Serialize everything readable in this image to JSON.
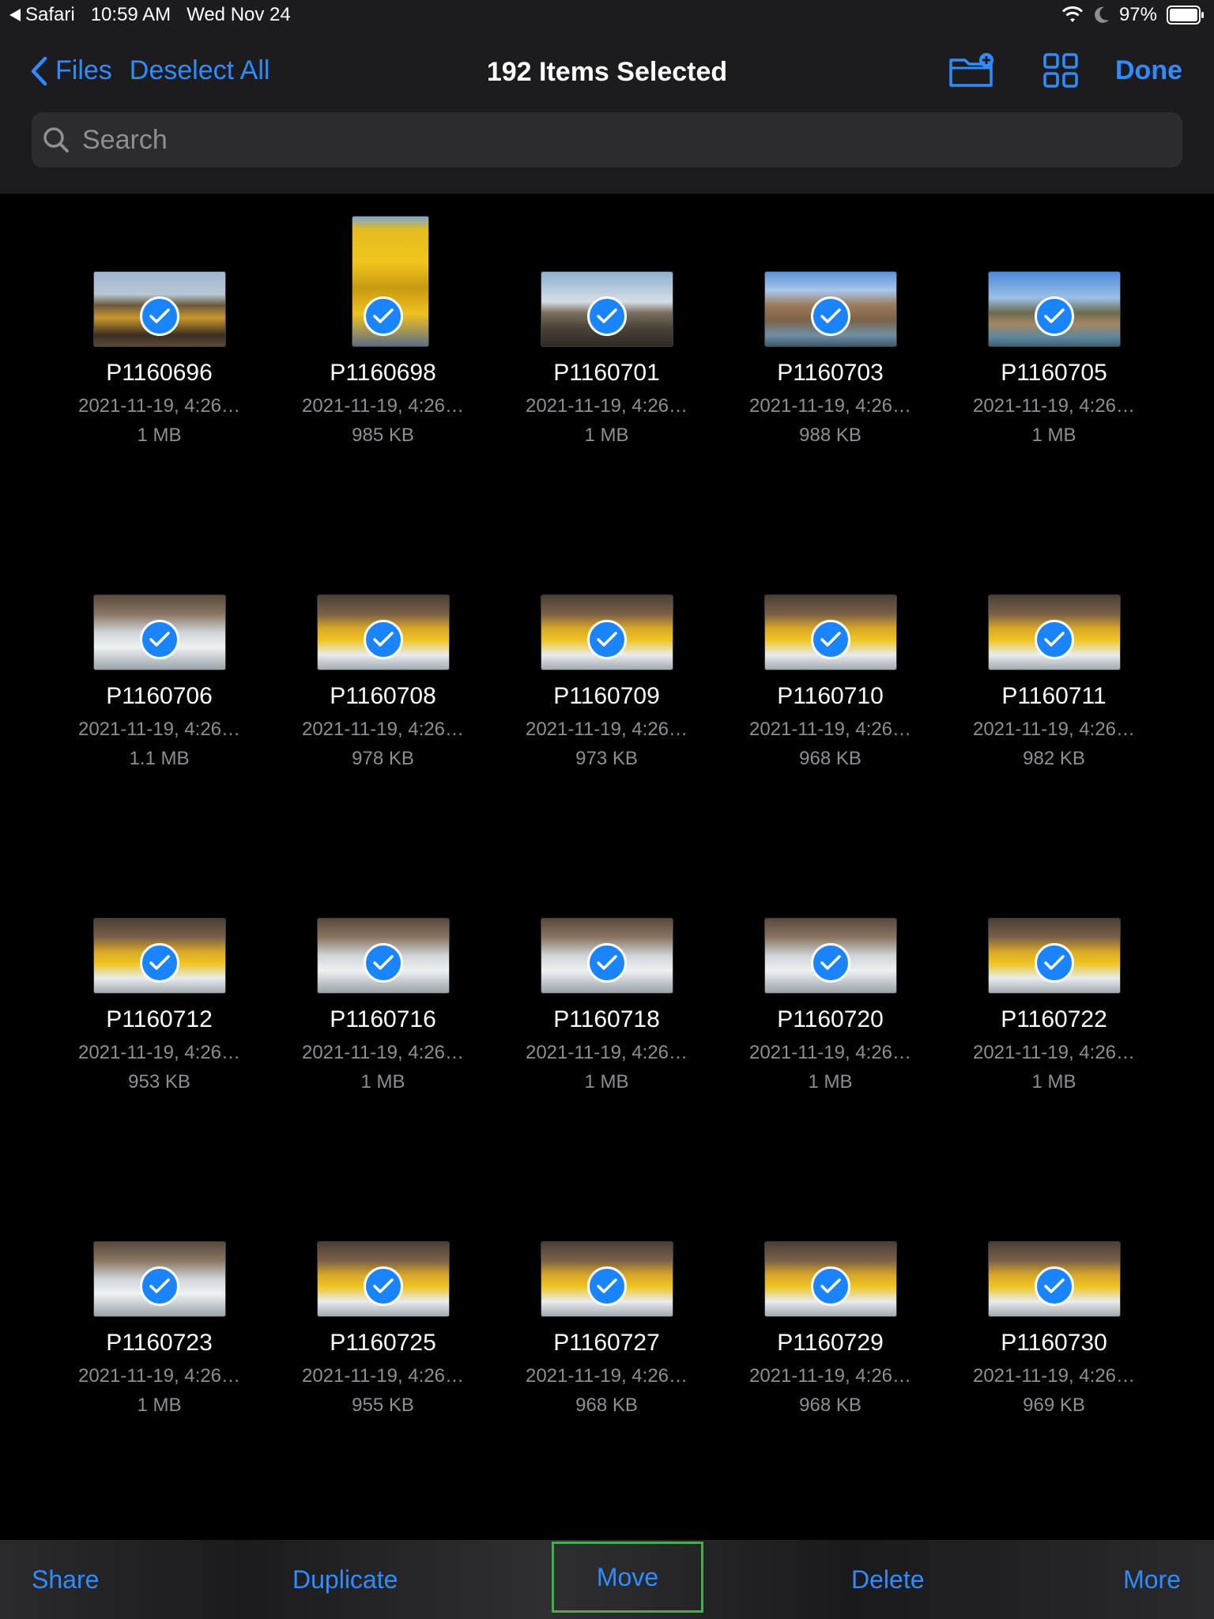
{
  "status_bar": {
    "back_app": "Safari",
    "time": "10:59 AM",
    "date": "Wed Nov 24",
    "battery": "97%"
  },
  "nav": {
    "back_label": "Files",
    "deselect_label": "Deselect All",
    "title": "192 Items Selected",
    "done_label": "Done"
  },
  "search": {
    "placeholder": "Search",
    "value": ""
  },
  "icons": {
    "back": "chevron-left-icon",
    "new_folder": "folder-plus-icon",
    "view_mode": "grid-view-icon",
    "search": "magnifying-glass-icon",
    "selected": "checkmark-circle-icon"
  },
  "colors": {
    "accent": "#2f8cff",
    "check": "#1a84ff",
    "highlight": "#3db24a"
  },
  "files": [
    {
      "name": "P1160696",
      "date": "2021-11-19, 4:26…",
      "size": "1 MB",
      "theme": "crowd"
    },
    {
      "name": "P1160698",
      "date": "2021-11-19, 4:26…",
      "size": "985 KB",
      "theme": "rafts",
      "portrait": true
    },
    {
      "name": "P1160701",
      "date": "2021-11-19, 4:26…",
      "size": "1 MB",
      "theme": "mountain"
    },
    {
      "name": "P1160703",
      "date": "2021-11-19, 4:26…",
      "size": "988 KB",
      "theme": "canyon"
    },
    {
      "name": "P1160705",
      "date": "2021-11-19, 4:26…",
      "size": "1 MB",
      "theme": "tree"
    },
    {
      "name": "P1160706",
      "date": "2021-11-19, 4:26…",
      "size": "1.1 MB",
      "theme": "water"
    },
    {
      "name": "P1160708",
      "date": "2021-11-19, 4:26…",
      "size": "978 KB",
      "theme": "raft"
    },
    {
      "name": "P1160709",
      "date": "2021-11-19, 4:26…",
      "size": "973 KB",
      "theme": "raft"
    },
    {
      "name": "P1160710",
      "date": "2021-11-19, 4:26…",
      "size": "968 KB",
      "theme": "raft"
    },
    {
      "name": "P1160711",
      "date": "2021-11-19, 4:26…",
      "size": "982 KB",
      "theme": "raft"
    },
    {
      "name": "P1160712",
      "date": "2021-11-19, 4:26…",
      "size": "953 KB",
      "theme": "raft"
    },
    {
      "name": "P1160716",
      "date": "2021-11-19, 4:26…",
      "size": "1 MB",
      "theme": "water"
    },
    {
      "name": "P1160718",
      "date": "2021-11-19, 4:26…",
      "size": "1 MB",
      "theme": "water"
    },
    {
      "name": "P1160720",
      "date": "2021-11-19, 4:26…",
      "size": "1 MB",
      "theme": "water"
    },
    {
      "name": "P1160722",
      "date": "2021-11-19, 4:26…",
      "size": "1 MB",
      "theme": "raft"
    },
    {
      "name": "P1160723",
      "date": "2021-11-19, 4:26…",
      "size": "1 MB",
      "theme": "water"
    },
    {
      "name": "P1160725",
      "date": "2021-11-19, 4:26…",
      "size": "955 KB",
      "theme": "raft"
    },
    {
      "name": "P1160727",
      "date": "2021-11-19, 4:26…",
      "size": "968 KB",
      "theme": "raft"
    },
    {
      "name": "P1160729",
      "date": "2021-11-19, 4:26…",
      "size": "968 KB",
      "theme": "raft"
    },
    {
      "name": "P1160730",
      "date": "2021-11-19, 4:26…",
      "size": "969 KB",
      "theme": "raft"
    }
  ],
  "toolbar": {
    "share": "Share",
    "duplicate": "Duplicate",
    "move": "Move",
    "delete": "Delete",
    "more": "More"
  }
}
